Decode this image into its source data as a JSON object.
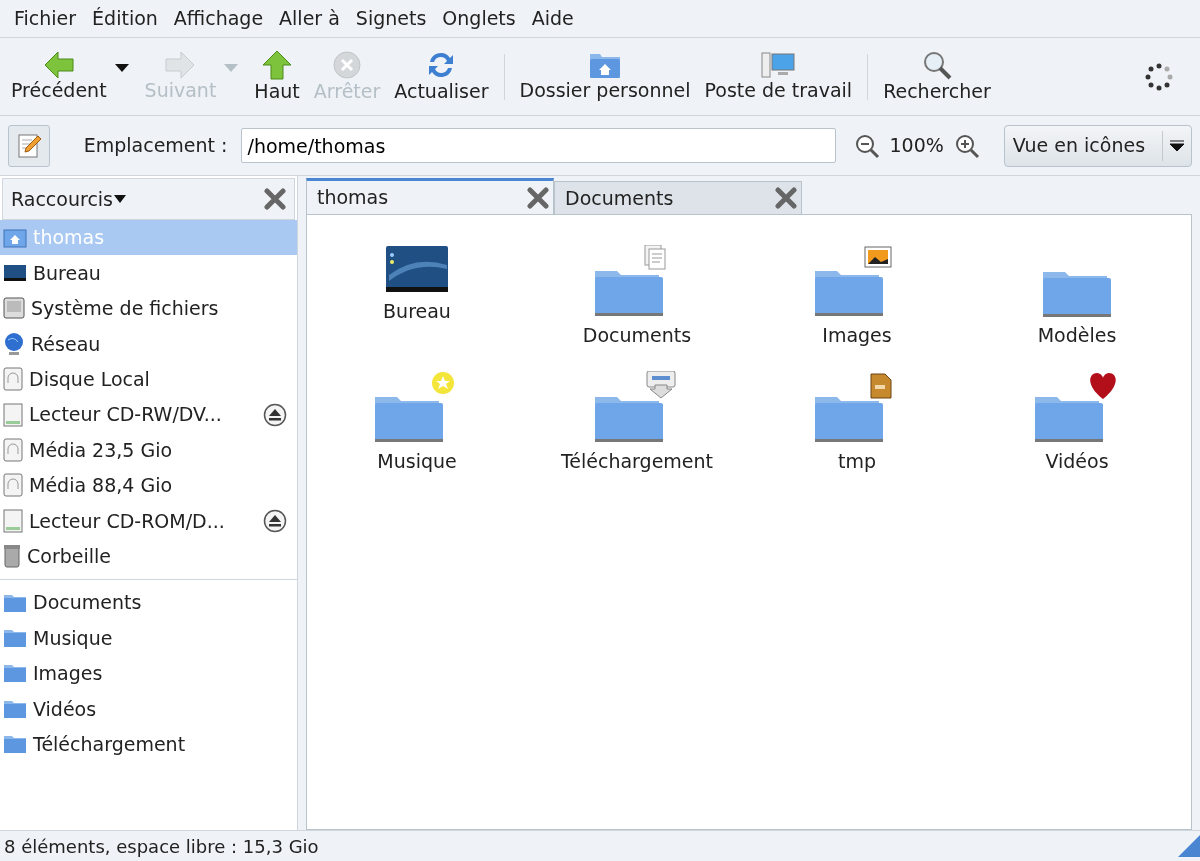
{
  "menu": [
    "Fichier",
    "Édition",
    "Affichage",
    "Aller à",
    "Signets",
    "Onglets",
    "Aide"
  ],
  "toolbar": [
    {
      "kind": "button",
      "label": "Précédent",
      "disabled": false,
      "dropdown": true
    },
    {
      "kind": "button",
      "label": "Suivant",
      "disabled": true,
      "dropdown": true
    },
    {
      "kind": "button",
      "label": "Haut",
      "disabled": false,
      "dropdown": false
    },
    {
      "kind": "button",
      "label": "Arrêter",
      "disabled": true,
      "dropdown": false
    },
    {
      "kind": "button",
      "label": "Actualiser",
      "disabled": false,
      "dropdown": false
    },
    {
      "kind": "separator"
    },
    {
      "kind": "button",
      "label": "Dossier personnel",
      "disabled": false,
      "dropdown": false
    },
    {
      "kind": "button",
      "label": "Poste de travail",
      "disabled": false,
      "dropdown": false
    },
    {
      "kind": "separator"
    },
    {
      "kind": "button",
      "label": "Rechercher",
      "disabled": false,
      "dropdown": false
    },
    {
      "kind": "spinner"
    }
  ],
  "location": {
    "label": "Emplacement :",
    "value": "/home/thomas",
    "zoom": "100%",
    "view": "Vue en icônes"
  },
  "sidebar": {
    "title": "Raccourcis",
    "places": [
      {
        "label": "thomas",
        "selected": true,
        "ejectable": false
      },
      {
        "label": "Bureau",
        "selected": false,
        "ejectable": false
      },
      {
        "label": "Système de fichiers",
        "selected": false,
        "ejectable": false
      },
      {
        "label": "Réseau",
        "selected": false,
        "ejectable": false
      },
      {
        "label": "Disque Local",
        "selected": false,
        "ejectable": false
      },
      {
        "label": "Lecteur CD-RW/DV...",
        "selected": false,
        "ejectable": true
      },
      {
        "label": "Média 23,5 Gio",
        "selected": false,
        "ejectable": false
      },
      {
        "label": "Média 88,4 Gio",
        "selected": false,
        "ejectable": false
      },
      {
        "label": "Lecteur CD-ROM/D...",
        "selected": false,
        "ejectable": true
      },
      {
        "label": "Corbeille",
        "selected": false,
        "ejectable": false
      }
    ],
    "bookmarks": [
      {
        "label": "Documents",
        "selected": false
      },
      {
        "label": "Musique",
        "selected": false
      },
      {
        "label": "Images",
        "selected": false
      },
      {
        "label": "Vidéos",
        "selected": false
      },
      {
        "label": "Téléchargement",
        "selected": false
      }
    ]
  },
  "tabs": [
    {
      "label": "thomas",
      "selected": true
    },
    {
      "label": "Documents",
      "selected": false
    }
  ],
  "files": [
    {
      "label": "Bureau"
    },
    {
      "label": "Documents"
    },
    {
      "label": "Images"
    },
    {
      "label": "Modèles"
    },
    {
      "label": "Musique"
    },
    {
      "label": "Téléchargement"
    },
    {
      "label": "tmp"
    },
    {
      "label": "Vidéos"
    }
  ],
  "status_bar": "8 éléments, espace libre : 15,3 Gio"
}
